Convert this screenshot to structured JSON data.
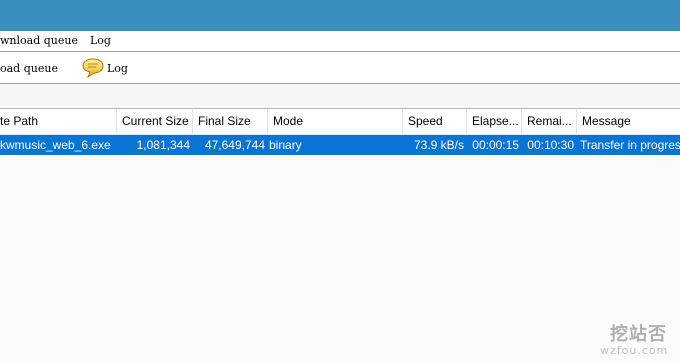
{
  "menu": {
    "items": [
      {
        "label": "wnload queue"
      },
      {
        "label": "Log"
      }
    ]
  },
  "toolbar": {
    "buttons": [
      {
        "label": "oad queue",
        "icon": "queue-icon"
      },
      {
        "label": "Log",
        "icon": "speech-bubble-icon"
      }
    ]
  },
  "grid": {
    "columns": [
      "te Path",
      "Current Size",
      "Final Size",
      "Mode",
      "Speed",
      "Elapse...",
      "Remai...",
      "Message"
    ],
    "rows": [
      {
        "path": "kwmusic_web_6.exe",
        "current_size": "1,081,344",
        "final_size": "47,649,744",
        "mode": "binary",
        "speed": "73.9 kB/s",
        "elapsed": "00:00:15",
        "remaining": "00:10:30",
        "message": "Transfer in progress."
      }
    ]
  },
  "watermark": {
    "logo": "挖站否",
    "domain": "wzfou.com"
  },
  "colors": {
    "titlebar": "#3a8fbf",
    "selection": "#0a74d5"
  }
}
